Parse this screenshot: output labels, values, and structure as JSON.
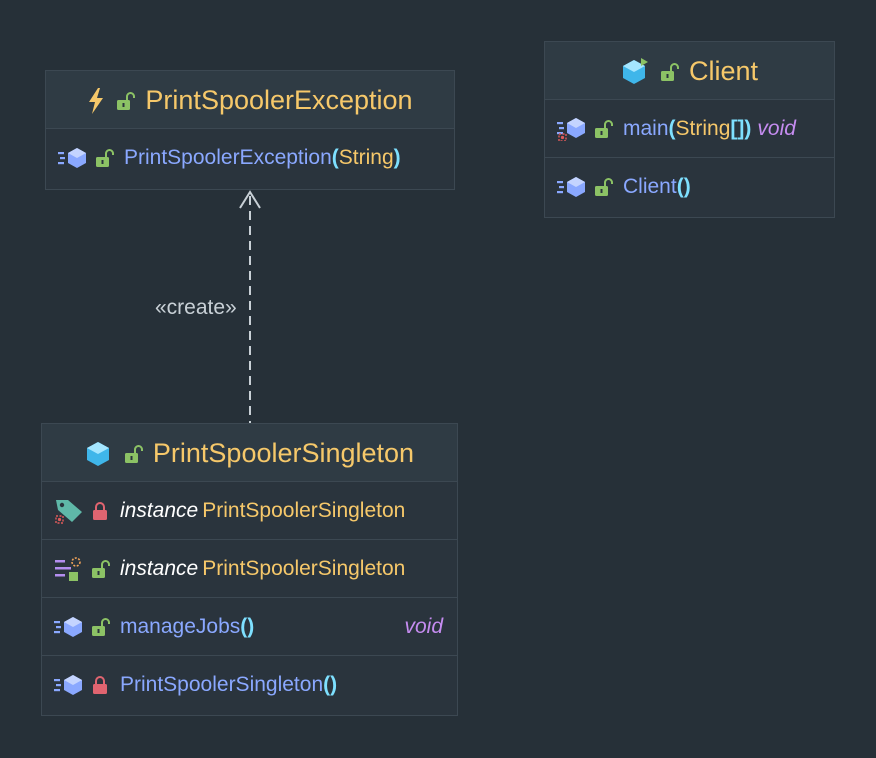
{
  "colors": {
    "background": "#263038",
    "class_name": "#f6c86a",
    "member_name": "#8aa8ff",
    "type": "#f6c86a",
    "keyword": "#c58cf0",
    "paren": "#7ee0ff"
  },
  "relation": {
    "label": "«create»"
  },
  "classes": {
    "exception": {
      "name": "PrintSpoolerException",
      "icon": "exception-bolt-icon",
      "members": [
        {
          "name": "PrintSpoolerException",
          "open": "(",
          "param": "String",
          "close": ")"
        }
      ]
    },
    "client": {
      "name": "Client",
      "icon": "class-icon",
      "members": [
        {
          "name": "main",
          "open": "(",
          "param": "String",
          "brackets": "[]",
          "close": ")",
          "returns": "void"
        },
        {
          "name": "Client",
          "parens": "()"
        }
      ]
    },
    "singleton": {
      "name": "PrintSpoolerSingleton",
      "icon": "class-icon",
      "members": [
        {
          "field": "instance",
          "type": "PrintSpoolerSingleton"
        },
        {
          "field": "instance",
          "type": "PrintSpoolerSingleton"
        },
        {
          "name": "manageJobs",
          "parens": "()",
          "returns": "void"
        },
        {
          "name": "PrintSpoolerSingleton",
          "parens": "()"
        }
      ]
    }
  }
}
